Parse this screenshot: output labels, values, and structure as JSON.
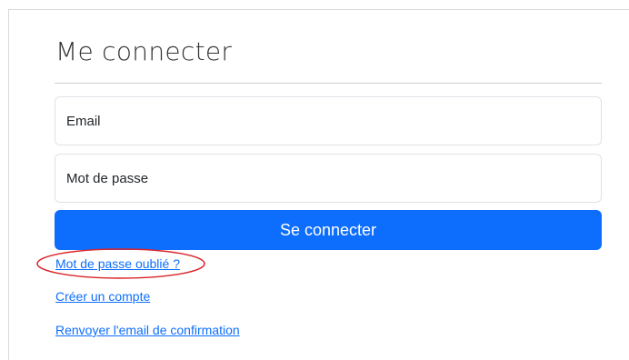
{
  "login": {
    "title": "Me connecter",
    "email_placeholder": "Email",
    "password_placeholder": "Mot de passe",
    "submit_label": "Se connecter"
  },
  "links": {
    "forgot_password": "Mot de passe oublié ?",
    "create_account": "Créer un compte",
    "resend_confirmation": "Renvoyer l'email de confirmation"
  },
  "colors": {
    "primary": "#0d6efd",
    "annotation": "#d9252a",
    "input_border": "#dee2e6"
  }
}
